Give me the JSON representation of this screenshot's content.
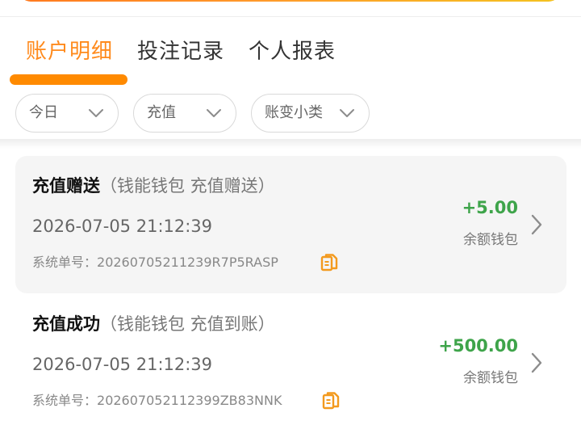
{
  "tabs": [
    {
      "label": "账户明细",
      "active": true
    },
    {
      "label": "投注记录",
      "active": false
    },
    {
      "label": "个人报表",
      "active": false
    }
  ],
  "filters": [
    {
      "label": "今日"
    },
    {
      "label": "充值"
    },
    {
      "label": "账变小类"
    }
  ],
  "records": [
    {
      "title": "充值赠送",
      "subtitle": "（钱能钱包 充值赠送）",
      "time": "2026-07-05 21:12:39",
      "order_label": "系统单号：",
      "order_id": "20260705211239R7P5RASP",
      "amount": "+5.00",
      "wallet": "余额钱包",
      "highlighted": true
    },
    {
      "title": "充值成功",
      "subtitle": "（钱能钱包 充值到账）",
      "time": "2026-07-05 21:12:39",
      "order_label": "系统单号：",
      "order_id": "202607052112399ZB83NNK",
      "amount": "+500.00",
      "wallet": "余额钱包",
      "highlighted": false
    }
  ],
  "colors": {
    "accent": "#ff8a1c",
    "positive_amount": "#3ea44a",
    "card_background": "#f5f5f5"
  },
  "icons": {
    "filter_chevron": "chevron-down-icon",
    "copy": "copy-icon",
    "item_chevron": "chevron-right-icon"
  }
}
